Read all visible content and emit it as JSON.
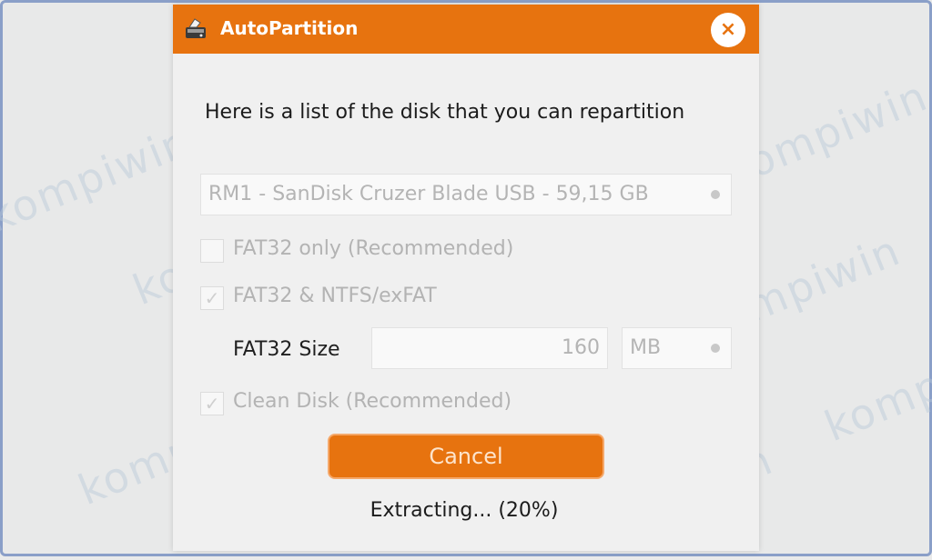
{
  "window": {
    "title": "AutoPartition",
    "close_icon": "×"
  },
  "heading": "Here is a list of the disk that you can repartition",
  "disk_select": {
    "value": "RM1 - SanDisk Cruzer Blade USB - 59,15 GB"
  },
  "options": [
    {
      "label": "FAT32 only (Recommended)",
      "checked": false
    },
    {
      "label": "FAT32 & NTFS/exFAT",
      "checked": true
    }
  ],
  "fat32_size": {
    "label": "FAT32 Size",
    "value": "160",
    "unit": "MB"
  },
  "clean_disk": {
    "label": "Clean Disk (Recommended)",
    "checked": true
  },
  "cancel_label": "Cancel",
  "status": "Extracting... (20%)",
  "watermark": "kompiwin",
  "colors": {
    "accent": "#e7730f",
    "background": "#f0f0f0",
    "disabled_text": "#b3b3b3"
  }
}
